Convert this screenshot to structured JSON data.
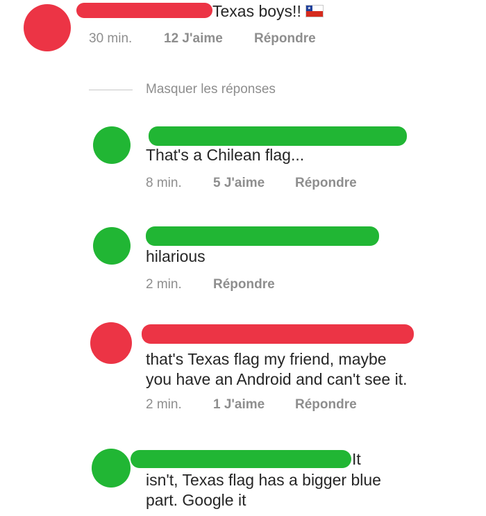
{
  "comments": [
    {
      "text": "Texas boys!!",
      "has_flag_icon": true,
      "time": "30 min.",
      "likes": "12 J'aime",
      "reply": "Répondre",
      "redaction_color": "#ec3445"
    },
    {
      "text": "That's a Chilean flag...",
      "time": "8 min.",
      "likes": "5 J'aime",
      "reply": "Répondre",
      "redaction_color": "#21b634"
    },
    {
      "text": "hilarious",
      "time": "2 min.",
      "reply": "Répondre",
      "redaction_color": "#21b634"
    },
    {
      "text_line1": "that's Texas flag my friend, maybe",
      "text_line2": "you have an Android and can't see it.",
      "time": "2 min.",
      "likes": "1 J'aime",
      "reply": "Répondre",
      "redaction_color": "#ec3445"
    },
    {
      "text_line0_tail": "It",
      "text_line1": "isn't, Texas flag has a bigger blue",
      "text_line2": "part. Google it",
      "redaction_color": "#21b634"
    }
  ],
  "hide_replies": "Masquer les réponses"
}
